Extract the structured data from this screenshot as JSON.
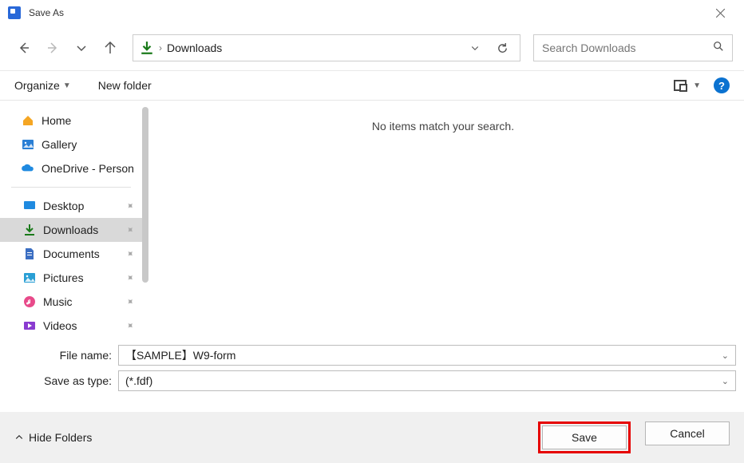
{
  "window": {
    "title": "Save As"
  },
  "address": {
    "location": "Downloads"
  },
  "search": {
    "placeholder": "Search Downloads"
  },
  "toolbar": {
    "organize": "Organize",
    "new_folder": "New folder",
    "help": "?"
  },
  "sidebar": {
    "top": [
      {
        "label": "Home"
      },
      {
        "label": "Gallery"
      },
      {
        "label": "OneDrive - Person"
      }
    ],
    "pinned": [
      {
        "label": "Desktop"
      },
      {
        "label": "Downloads",
        "selected": true
      },
      {
        "label": "Documents"
      },
      {
        "label": "Pictures"
      },
      {
        "label": "Music"
      },
      {
        "label": "Videos"
      }
    ]
  },
  "content": {
    "empty": "No items match your search."
  },
  "form": {
    "filename_label": "File name:",
    "filename_value": "【SAMPLE】W9-form",
    "type_label": "Save as type:",
    "type_value": " (*.fdf)"
  },
  "footer": {
    "hide_folders": "Hide Folders",
    "save": "Save",
    "cancel": "Cancel"
  }
}
